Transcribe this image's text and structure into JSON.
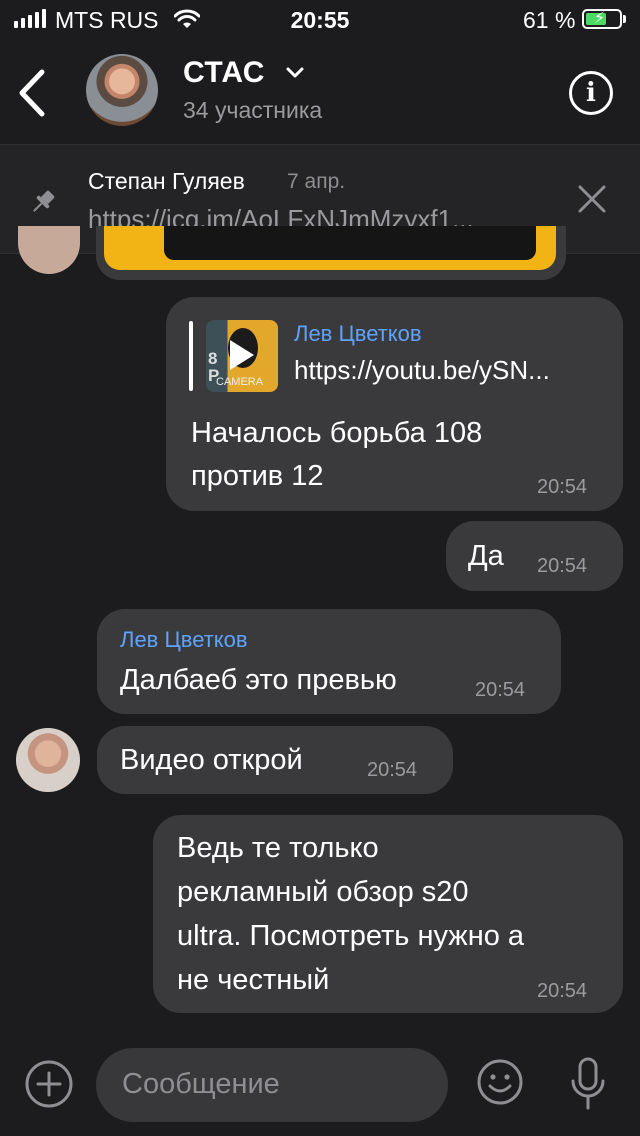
{
  "status_bar": {
    "carrier": "MTS RUS",
    "time": "20:55",
    "battery": "61 %",
    "battery_level": 0.61
  },
  "header": {
    "title": "СТАС",
    "subtitle": "34 участника"
  },
  "pinned": {
    "author": "Степан Гуляев",
    "date": "7 апр.",
    "text": "https://icq.im/AoLFxNJmMzyxf1..."
  },
  "messages": [
    {
      "quote_author": "Лев Цветков",
      "quote_text": "https://youtu.be/ySN...",
      "text_line1": "Началось борьба 108",
      "text_line2": "против 12",
      "time": "20:54"
    },
    {
      "text": "Да",
      "time": "20:54"
    },
    {
      "author": "Лев Цветков",
      "text": "Далбаеб это превью",
      "time": "20:54"
    },
    {
      "text": "Видео открой",
      "time": "20:54"
    },
    {
      "text_line1": "Ведь те только",
      "text_line2": "рекламный обзор s20",
      "text_line3": "ultra. Посмотреть нужно а",
      "text_line4": "не честный",
      "time": "20:54"
    }
  ],
  "thumbnail": {
    "side_text": "8\nP",
    "caption": "CAMERA"
  },
  "composer": {
    "placeholder": "Сообщение"
  },
  "colors": {
    "background": "#1c1c1e",
    "bubble": "#3a3a3c",
    "accent": "#5ea3ff",
    "battery": "#4cd964"
  }
}
